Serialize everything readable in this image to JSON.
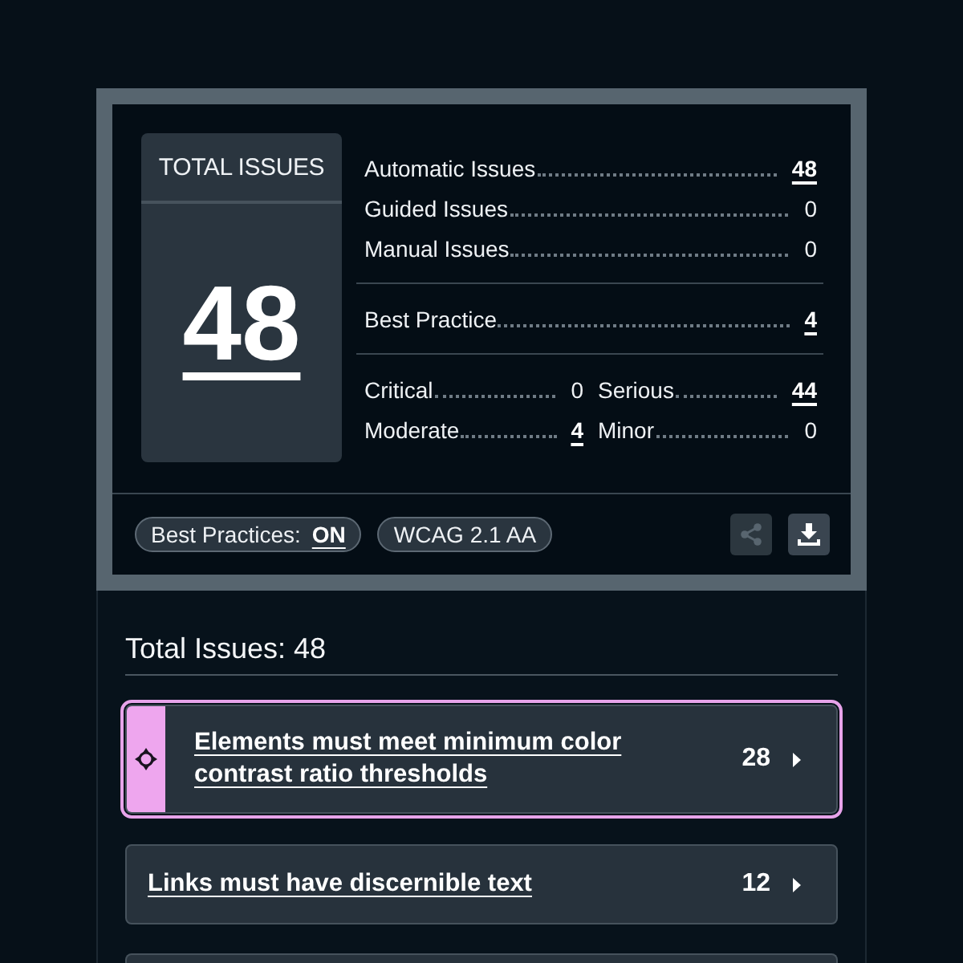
{
  "summary": {
    "total": {
      "title": "TOTAL ISSUES",
      "value": "48"
    },
    "counts": [
      {
        "label": "Automatic Issues",
        "value": "48",
        "linked": true
      },
      {
        "label": "Guided Issues",
        "value": "0",
        "linked": false
      },
      {
        "label": "Manual Issues",
        "value": "0",
        "linked": false
      }
    ],
    "best_practice": {
      "label": "Best Practice",
      "value": "4",
      "linked": true
    },
    "severity": [
      {
        "label": "Critical",
        "value": "0",
        "linked": false
      },
      {
        "label": "Serious",
        "value": "44",
        "linked": true
      },
      {
        "label": "Moderate",
        "value": "4",
        "linked": true
      },
      {
        "label": "Minor",
        "value": "0",
        "linked": false
      }
    ],
    "tags": [
      {
        "kind": "toggle",
        "label": "Best Practices:",
        "value": "ON"
      },
      {
        "kind": "standard",
        "label": "WCAG 2.1 AA"
      }
    ],
    "actions": [
      {
        "kind": "share",
        "disabled": true
      },
      {
        "kind": "download",
        "disabled": false
      }
    ]
  },
  "issues": {
    "heading": "Total Issues: 48",
    "items": [
      {
        "title": "Elements must meet minimum color contrast ratio thresholds",
        "count": "28",
        "selected": true
      },
      {
        "title": "Links must have discernible text",
        "count": "12",
        "selected": false
      }
    ]
  }
}
